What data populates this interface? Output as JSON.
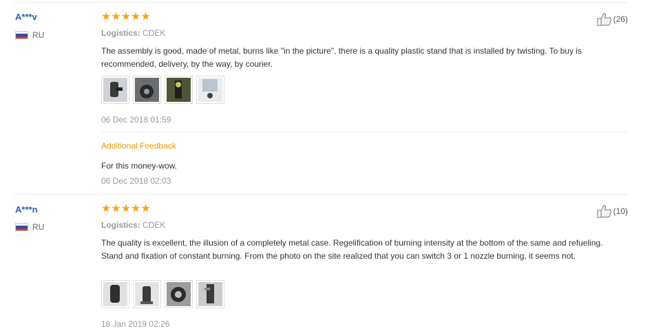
{
  "reviews": [
    {
      "user": "A***v",
      "country": "RU",
      "stars": "★★★★★",
      "rating": 5,
      "likes": "(26)",
      "logistics_label": "Logistics:",
      "logistics_value": "CDEK",
      "text": "The assembly is good, made of metal, burns like \"in the picture\", there is a quality plastic stand that is installed by twisting. To buy is recommended, delivery, by the way, by courier.",
      "date": "06 Dec 2018 01:59",
      "photos": [
        "photo-1",
        "photo-2",
        "photo-3",
        "photo-4"
      ],
      "additional_feedback": {
        "label": "Additional Feedback",
        "text": "For this money-wow.",
        "date": "06 Dec 2018 02:03"
      }
    },
    {
      "user": "A***n",
      "country": "RU",
      "stars": "★★★★★",
      "rating": 5,
      "likes": "(10)",
      "logistics_label": "Logistics:",
      "logistics_value": "CDEK",
      "text": "The quality is excellent, the illusion of a completely metal case. Regelification of burning intensity at the bottom of the same and refueling. Stand and fixation of constant burning. From the photo on the site realized that you can switch 3 or 1 nozzle burning, it seems not.",
      "date": "18 Jan 2019 02:26",
      "photos": [
        "photo-1",
        "photo-2",
        "photo-3",
        "photo-4"
      ]
    }
  ],
  "colors": {
    "star": "#f7a21a",
    "username": "#2c5fad",
    "additional_feedback": "#f39800",
    "muted_text": "#999999"
  },
  "icons": {
    "like": "thumbs-up-icon",
    "flag": "russia-flag-icon"
  }
}
